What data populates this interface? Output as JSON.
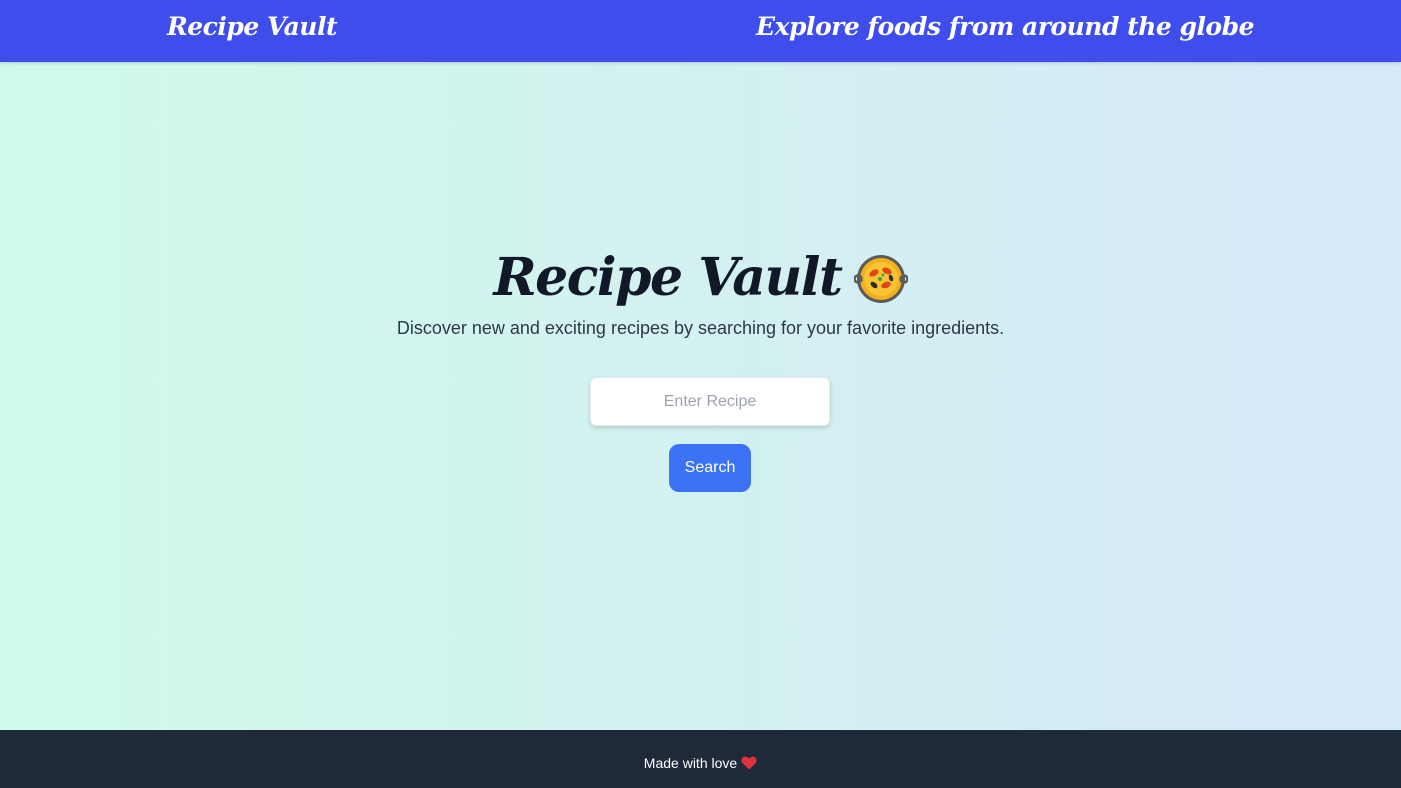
{
  "header": {
    "brand": "Recipe Vault",
    "tagline": "Explore foods from around the globe"
  },
  "hero": {
    "title": "Recipe Vault",
    "title_icon": "paella-icon",
    "subtitle": "Discover new and exciting recipes by searching for your favorite ingredients."
  },
  "search": {
    "value": "",
    "placeholder": "Enter Recipe",
    "button_label": "Search"
  },
  "footer": {
    "text": "Made with love",
    "icon": "heart-icon"
  },
  "colors": {
    "header_bg": "#3f4ded",
    "footer_bg": "#1e2939",
    "button_bg": "#3b72f6",
    "title_text": "#111827"
  }
}
